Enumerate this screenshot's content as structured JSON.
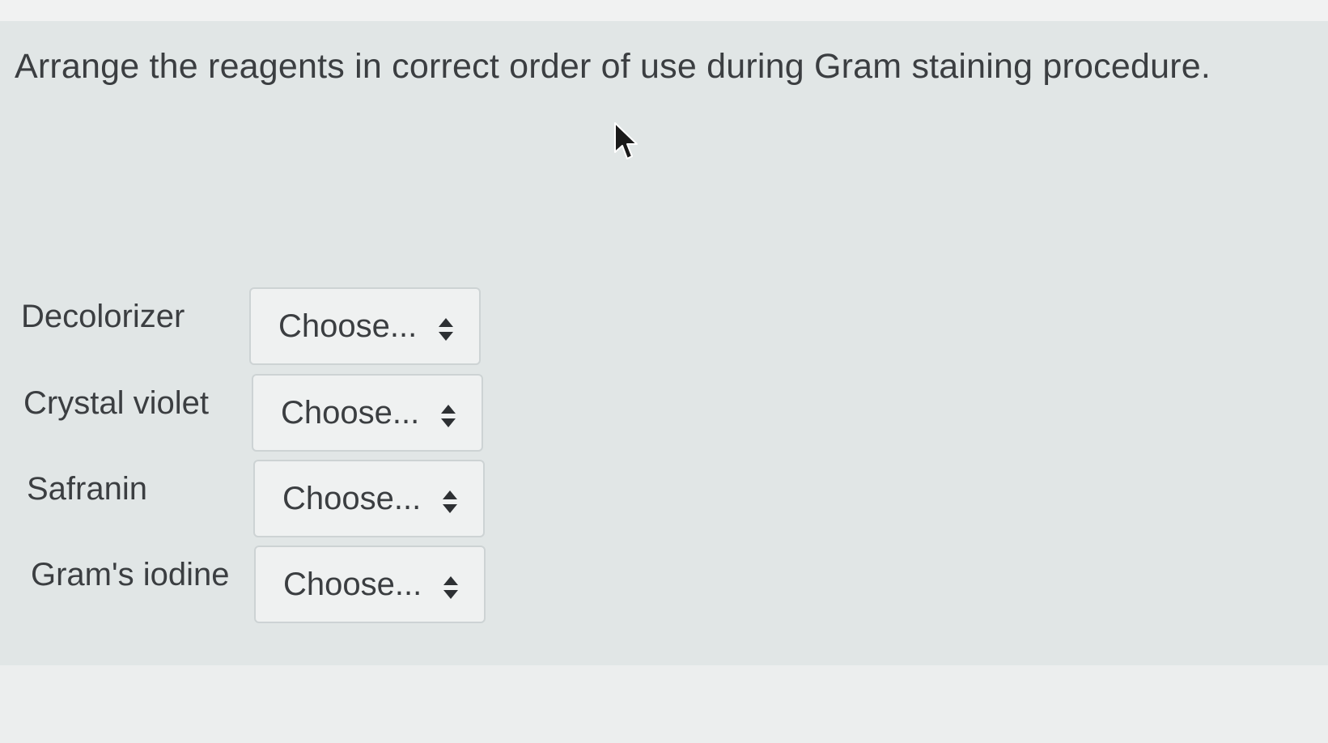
{
  "question": {
    "text": "Arrange the reagents in correct order of use during Gram staining procedure."
  },
  "match_rows": [
    {
      "label": "Decolorizer",
      "selected": "Choose..."
    },
    {
      "label": "Crystal violet",
      "selected": "Choose..."
    },
    {
      "label": "Safranin",
      "selected": "Choose..."
    },
    {
      "label": "Gram's iodine",
      "selected": "Choose..."
    }
  ],
  "icons": {
    "select_arrows": "sort-updown-icon",
    "pointer": "mouse-pointer-icon"
  },
  "colors": {
    "panel_background": "#e1e6e6",
    "text": "#3b3e41",
    "select_border": "#cdd3d4",
    "select_background": "#eff1f1"
  }
}
